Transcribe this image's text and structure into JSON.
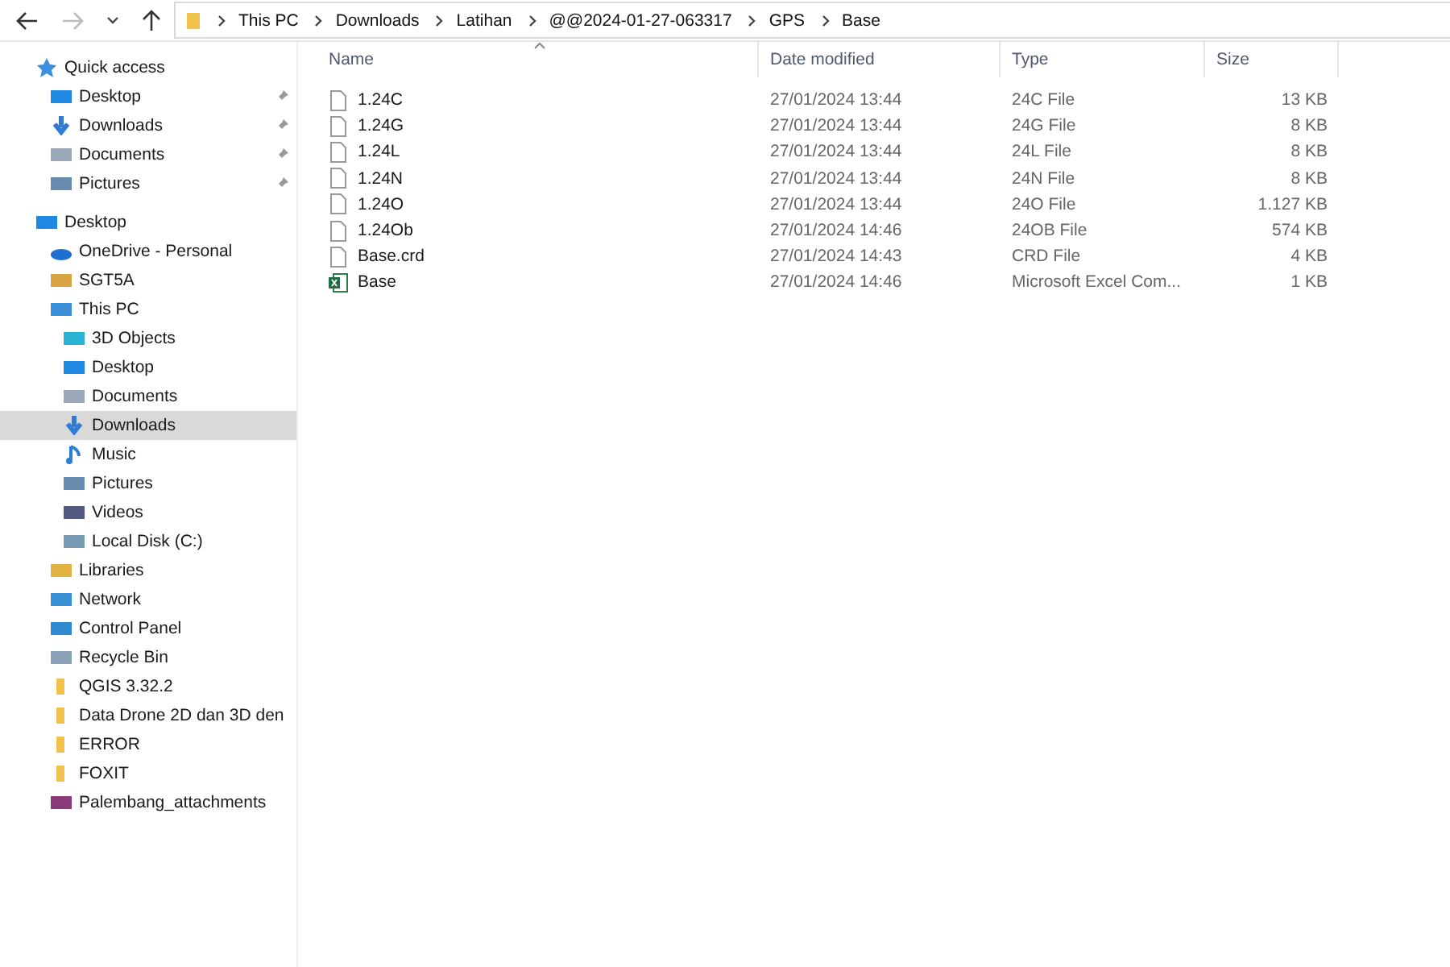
{
  "address_bar": {
    "path": [
      "This PC",
      "Downloads",
      "Latihan",
      "@@2024-01-27-063317",
      "GPS",
      "Base"
    ]
  },
  "sidebar": {
    "groups": [
      {
        "label": "Quick access",
        "kind": "star",
        "selected": false,
        "children": [
          {
            "label": "Desktop",
            "kind": "monitor",
            "pinned": true,
            "selected": false
          },
          {
            "label": "Downloads",
            "kind": "download",
            "pinned": true,
            "selected": false
          },
          {
            "label": "Documents",
            "kind": "document",
            "pinned": true,
            "selected": false
          },
          {
            "label": "Pictures",
            "kind": "picture",
            "pinned": true,
            "selected": false
          }
        ]
      },
      {
        "label": "Desktop",
        "kind": "monitor",
        "selected": false,
        "children": [
          {
            "label": "OneDrive - Personal",
            "kind": "cloud",
            "selected": false
          },
          {
            "label": "SGT5A",
            "kind": "user",
            "selected": false
          },
          {
            "label": "This PC",
            "kind": "pc",
            "selected": false,
            "children": [
              {
                "label": "3D Objects",
                "kind": "cube",
                "selected": false
              },
              {
                "label": "Desktop",
                "kind": "monitor",
                "selected": false
              },
              {
                "label": "Documents",
                "kind": "document",
                "selected": false
              },
              {
                "label": "Downloads",
                "kind": "download",
                "selected": true
              },
              {
                "label": "Music",
                "kind": "music",
                "selected": false
              },
              {
                "label": "Pictures",
                "kind": "picture",
                "selected": false
              },
              {
                "label": "Videos",
                "kind": "video",
                "selected": false
              },
              {
                "label": "Local Disk (C:)",
                "kind": "disk",
                "selected": false
              }
            ]
          },
          {
            "label": "Libraries",
            "kind": "library",
            "selected": false
          },
          {
            "label": "Network",
            "kind": "network",
            "selected": false
          },
          {
            "label": "Control Panel",
            "kind": "panel",
            "selected": false
          },
          {
            "label": "Recycle Bin",
            "kind": "bin",
            "selected": false
          },
          {
            "label": "QGIS 3.32.2",
            "kind": "folder",
            "selected": false
          },
          {
            "label": "Data Drone 2D dan 3D den",
            "kind": "folder",
            "selected": false
          },
          {
            "label": "ERROR",
            "kind": "folder",
            "selected": false
          },
          {
            "label": "FOXIT",
            "kind": "folder",
            "selected": false
          },
          {
            "label": "Palembang_attachments",
            "kind": "archive",
            "selected": false
          }
        ]
      }
    ]
  },
  "table": {
    "columns": [
      "Name",
      "Date modified",
      "Type",
      "Size"
    ],
    "rows": [
      {
        "name": "1.24C",
        "kind": "file",
        "date": "27/01/2024 13:44",
        "type": "24C File",
        "size": "13 KB"
      },
      {
        "name": "1.24G",
        "kind": "file",
        "date": "27/01/2024 13:44",
        "type": "24G File",
        "size": "8 KB"
      },
      {
        "name": "1.24L",
        "kind": "file",
        "date": "27/01/2024 13:44",
        "type": "24L File",
        "size": "8 KB"
      },
      {
        "name": "1.24N",
        "kind": "file",
        "date": "27/01/2024 13:44",
        "type": "24N File",
        "size": "8 KB"
      },
      {
        "name": "1.24O",
        "kind": "file",
        "date": "27/01/2024 13:44",
        "type": "24O File",
        "size": "1.127 KB"
      },
      {
        "name": "1.24Ob",
        "kind": "file",
        "date": "27/01/2024 14:46",
        "type": "24OB File",
        "size": "574 KB"
      },
      {
        "name": "Base.crd",
        "kind": "file",
        "date": "27/01/2024 14:43",
        "type": "CRD File",
        "size": "4 KB"
      },
      {
        "name": "Base",
        "kind": "excel",
        "date": "27/01/2024 14:46",
        "type": "Microsoft Excel Com...",
        "size": "1 KB"
      }
    ]
  }
}
